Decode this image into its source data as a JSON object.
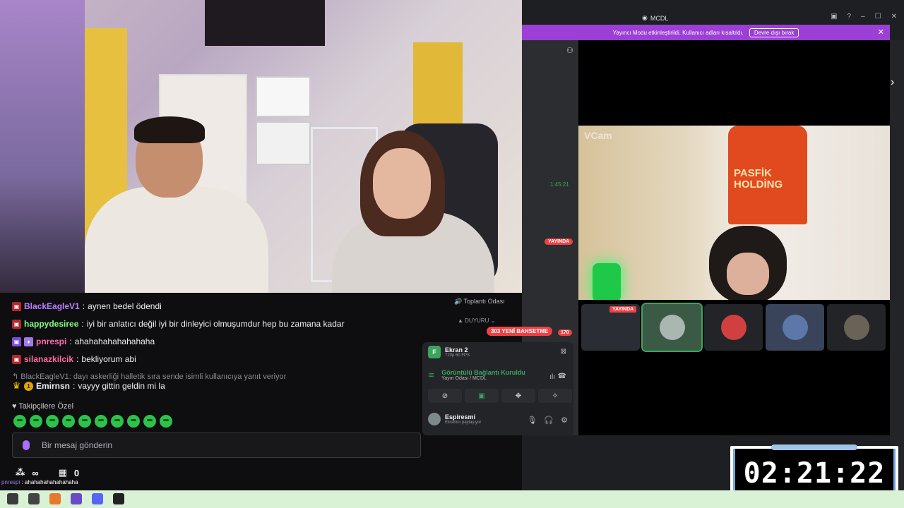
{
  "chat": {
    "messages": [
      {
        "user": "BlackEagleV1",
        "user_color": "#b880ff",
        "text": "aynen bedel ödendi"
      },
      {
        "user": "happydesiree",
        "user_color": "#7fff7f",
        "text": "iyi bir anlatıcı değil iyi bir dinleyici olmuşumdur hep bu zamana kadar"
      },
      {
        "user": "pnrespi",
        "user_color": "#ff69b4",
        "text": "ahahahahahahahaha"
      },
      {
        "user": "silanazkilcik",
        "user_color": "#ff6b9e",
        "text": "bekliyorum abi"
      }
    ],
    "reply_context": "BlackEagleV1: dayı askerliği halletik sıra sende isimli kullanıcıya yanıt veriyor",
    "reply_message": {
      "user": "Emirnsn",
      "user_color": "#ffffff",
      "badge_number": "1",
      "text": "vayyy gittin geldin mi la"
    },
    "followers_only": "Takipçilere Özel",
    "input_placeholder": "Bir mesaj gönderin",
    "stats": {
      "viewers": "∞",
      "points": "0"
    },
    "overlay_line": {
      "user": "pnrespi",
      "text": "ahahahahahahahaha"
    }
  },
  "discord": {
    "window_title": "MCDL",
    "banner_text": "Yayıncı Modu etkinleştirildi. Kullanıcı adları kısaltıldı.",
    "banner_button": "Devre dışı bırak",
    "stream_time": "1:45:21",
    "live_label": "YAYINDA",
    "thumb_live_label": "YAYINDA",
    "tile_watermark": "VCam",
    "jersey_text": [
      "PASFİK",
      "HOLDİNG"
    ],
    "room": "Toplantı Odası",
    "announce": "DUYURU",
    "new_mentions": "303 YENİ BAHSETME",
    "mention_count": "170",
    "screen": {
      "title": "Ekran 2",
      "subtitle": "720p 60 FPS"
    },
    "connection": {
      "title": "Görüntülü Bağlantı Kuruldu",
      "subtitle": "Yayın Odası / MCDL"
    },
    "user": {
      "name": "Espiresmi",
      "status": "Ekranını paylaşıyor"
    }
  },
  "timer": {
    "value": "02:21:22"
  },
  "colors": {
    "twitch_purple": "#9147ff",
    "discord_green": "#3ba55d",
    "live_red": "#ed4245",
    "banner": "#9b3fd6"
  }
}
